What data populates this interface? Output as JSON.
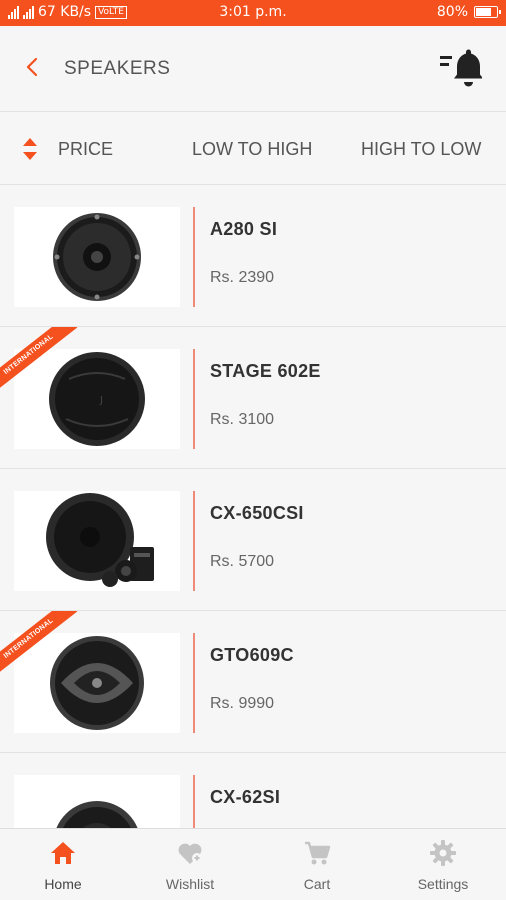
{
  "status_bar": {
    "network_speed": "67 KB/s",
    "volte": "VoLTE",
    "time": "3:01 p.m.",
    "battery": "80%",
    "battery_level": 0.8
  },
  "header": {
    "title": "SPEAKERS",
    "back_icon": "chevron-left-icon",
    "notification_icon": "bell-with-lines-icon"
  },
  "sort_bar": {
    "label": "PRICE",
    "low_to_high": "LOW TO HIGH",
    "high_to_low": "HIGH TO LOW"
  },
  "products": [
    {
      "name": "A280 SI",
      "price": "Rs. 2390",
      "badge": ""
    },
    {
      "name": "STAGE 602E",
      "price": "Rs. 3100",
      "badge": "INTERNATIONAL"
    },
    {
      "name": "CX-650CSI",
      "price": "Rs. 5700",
      "badge": ""
    },
    {
      "name": "GTO609C",
      "price": "Rs. 9990",
      "badge": "INTERNATIONAL"
    },
    {
      "name": "CX-62SI",
      "price": "",
      "badge": ""
    }
  ],
  "bottom_nav": [
    {
      "label": "Home",
      "icon": "home-icon",
      "active": true
    },
    {
      "label": "Wishlist",
      "icon": "heart-plus-icon",
      "active": false
    },
    {
      "label": "Cart",
      "icon": "cart-icon",
      "active": false
    },
    {
      "label": "Settings",
      "icon": "gear-icon",
      "active": false
    }
  ],
  "colors": {
    "accent": "#f4511e",
    "divider": "#f08a78",
    "background": "#f6f6f6",
    "inactive_icon": "#c4c4c4"
  }
}
